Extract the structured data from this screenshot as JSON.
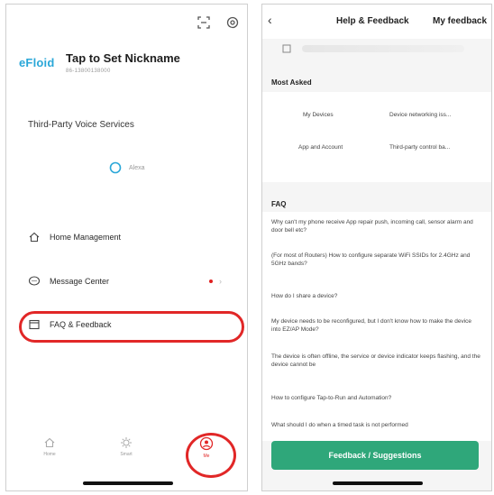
{
  "left": {
    "logo": "eFloid",
    "nickname": "Tap to Set Nickname",
    "account_id": "86-13800138000",
    "voice_services_label": "Third-Party Voice Services",
    "alexa_label": "Alexa",
    "menu": [
      {
        "label": "Home Management",
        "icon": "house-icon"
      },
      {
        "label": "Message Center",
        "icon": "chat-icon"
      },
      {
        "label": "FAQ & Feedback",
        "icon": "document-icon"
      }
    ],
    "tabs": [
      {
        "label": "Home",
        "icon": "home-icon"
      },
      {
        "label": "Smart",
        "icon": "sun-icon"
      },
      {
        "label": "Me",
        "icon": "profile-icon"
      }
    ],
    "highlight_color": "#e12727"
  },
  "right": {
    "title": "Help & Feedback",
    "my_feedback": "My feedback",
    "most_asked_label": "Most Asked",
    "most_asked": [
      "My Devices",
      "Device networking iss...",
      "App and Account",
      "Third-party control ba..."
    ],
    "faq_label": "FAQ",
    "faq": [
      "Why can't my phone receive App repair push, incoming call, sensor alarm and door bell etc?",
      "(For most of Routers) How to configure separate WiFi SSIDs for 2.4GHz and 5GHz bands?",
      "How do I share a device?",
      "My device needs to be reconfigured, but I don't know how to make the device into EZ/AP Mode?",
      "The device is often offline, the service or device indicator keeps flashing, and the device cannot be",
      "How to configure Tap-to-Run and Automation?",
      "What should I do when a timed task is not performed"
    ],
    "button_label": "Feedback / Suggestions",
    "accent_color": "#2fa77a"
  }
}
